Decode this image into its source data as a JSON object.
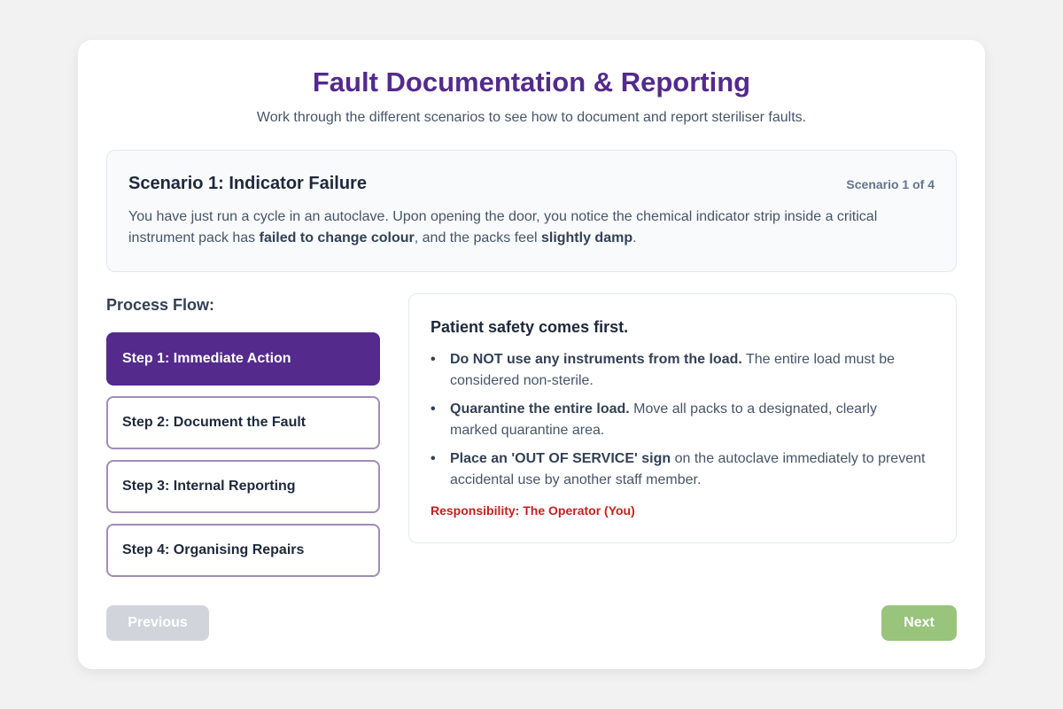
{
  "header": {
    "title": "Fault Documentation & Reporting",
    "subtitle": "Work through the different scenarios to see how to document and report steriliser faults."
  },
  "scenario": {
    "title": "Scenario 1: Indicator Failure",
    "counter": "Scenario 1 of 4",
    "text_part1": "You have just run a cycle in an autoclave. Upon opening the door, you notice the chemical indicator strip inside a critical instrument pack has ",
    "text_bold1": "failed to change colour",
    "text_part2": ", and the packs feel ",
    "text_bold2": "slightly damp",
    "text_part3": "."
  },
  "process": {
    "heading": "Process Flow:",
    "steps": [
      {
        "label": "Step 1: Immediate Action",
        "active": true
      },
      {
        "label": "Step 2: Document the Fault",
        "active": false
      },
      {
        "label": "Step 3: Internal Reporting",
        "active": false
      },
      {
        "label": "Step 4: Organising Repairs",
        "active": false
      }
    ]
  },
  "detail": {
    "heading": "Patient safety comes first.",
    "items": [
      {
        "bold": "Do NOT use any instruments from the load.",
        "text": " The entire load must be considered non-sterile."
      },
      {
        "bold": "Quarantine the entire load.",
        "text": " Move all packs to a designated, clearly marked quarantine area."
      },
      {
        "bold": "Place an 'OUT OF SERVICE' sign",
        "text": " on the autoclave immediately to prevent accidental use by another staff member."
      }
    ],
    "responsibility": "Responsibility: The Operator (You)"
  },
  "nav": {
    "previous_label": "Previous",
    "next_label": "Next"
  },
  "colors": {
    "accent": "#542a8c",
    "step_border": "#a08cb8",
    "responsibility": "#c81e1e",
    "next_button": "#98c47c",
    "previous_button_disabled": "#d1d5db"
  }
}
